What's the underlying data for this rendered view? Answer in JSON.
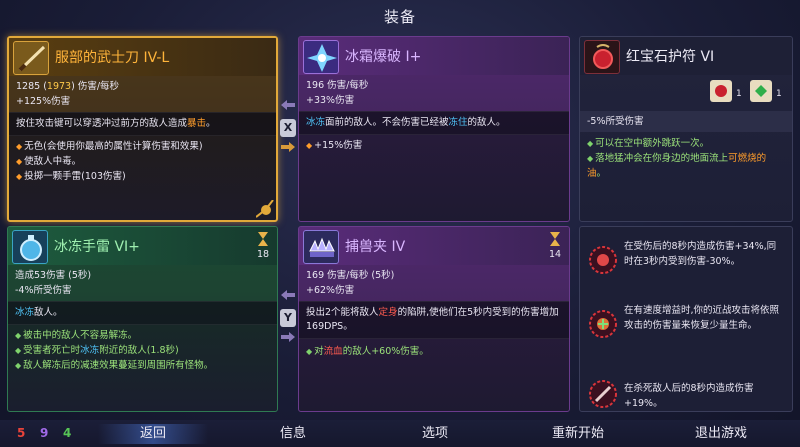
{
  "screen_title": "装备",
  "katana": {
    "name": "服部的武士刀 IV-L",
    "stat_base": "1285 (",
    "stat_alt": "1973",
    "stat_tail": ") 伤害/每秒",
    "stat2": "+125%伤害",
    "desc_a": "按住攻击键可以穿透冲过前方的敌人造成",
    "desc_hl": "暴击",
    "desc_b": "。",
    "extra1": "无色(会使用你最高的属性计算伤害和效果)",
    "extra2": "使敌人中毒。",
    "extra3": "投掷一颗手雷(103伤害)"
  },
  "frost": {
    "name": "冰霜爆破 I+",
    "stat1": "196 伤害/每秒",
    "stat2": "+33%伤害",
    "desc_hl1": "冰冻",
    "desc_a": "面前的敌人。不会伤害已经被",
    "desc_hl2": "冻住",
    "desc_b": "的敌人。",
    "extra1": "+15%伤害"
  },
  "amulet": {
    "name": "红宝石护符 VI",
    "scroll1_count": "1",
    "scroll2_count": "1",
    "stat1": "-5%所受伤害",
    "extra1": "可以在空中额外跳跃一次。",
    "extra2_a": "落地猛冲会在你身边的地面流上",
    "extra2_hl": "可燃烧的油",
    "extra2_b": "。"
  },
  "grenade": {
    "name": "冰冻手雷 VI+",
    "cooldown": "18",
    "stat1": "造成53伤害 (5秒)",
    "stat2": "-4%所受伤害",
    "desc_hl": "冰冻",
    "desc_b": "敌人。",
    "extra1": "被击中的敌人不容易解冻。",
    "extra2_a": "受害者死亡时",
    "extra2_hl": "冰冻",
    "extra2_b": "附近的敌人(1.8秒)",
    "extra3": "敌人解冻后的减速效果蔓延到周围所有怪物。"
  },
  "trap": {
    "name": "捕兽夹 IV",
    "cooldown": "14",
    "stat1": "169 伤害/每秒 (5秒)",
    "stat2": "+62%伤害",
    "desc_a": "投出2个能将敌人",
    "desc_hl": "定身",
    "desc_b": "的陷阱,使他们在5秒内受到的伤害增加169DPS。",
    "extra_a": "对",
    "extra_hl": "流血",
    "extra_b": "的敌人+60%伤害。"
  },
  "mutations": [
    {
      "text": "在受伤后的8秒内造成伤害+34%,同时在3秒内受到伤害-30%。",
      "icon": "mutation-blood-icon"
    },
    {
      "text": "在有速度增益时,你的近战攻击将依照攻击的伤害量来恢复少量生命。",
      "icon": "mutation-heal-icon"
    },
    {
      "text": "在杀死敌人后的8秒内造成伤害+19%。",
      "icon": "mutation-kill-icon"
    }
  ],
  "swap_buttons": {
    "top": "X",
    "bottom": "Y"
  },
  "scrolls": {
    "brutality": "5",
    "tactics": "9",
    "survival": "4"
  },
  "colors": {
    "brutality": "#e8433a",
    "tactics": "#a06ae8",
    "survival": "#57c456",
    "legendary_border": "#e2a93a"
  },
  "nav": {
    "back": "返回",
    "info": "信息",
    "options": "选项",
    "restart": "重新开始",
    "quit": "退出游戏"
  }
}
